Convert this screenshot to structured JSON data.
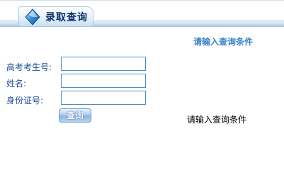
{
  "header": {
    "title": "录取查询",
    "icon": "diamond-logo-icon"
  },
  "prompt_top": "请输入查询条件",
  "form": {
    "fields": [
      {
        "label": "高考考生号:",
        "value": "",
        "placeholder": ""
      },
      {
        "label": "姓名:",
        "value": "",
        "placeholder": ""
      },
      {
        "label": "身份证号:",
        "value": "",
        "placeholder": ""
      }
    ],
    "submit_label": "查询"
  },
  "prompt_bottom": "请输入查询条件",
  "colors": {
    "label_blue": "#1f4f98",
    "prompt_blue": "#3a83c9",
    "border_blue": "#4f8fc3"
  }
}
